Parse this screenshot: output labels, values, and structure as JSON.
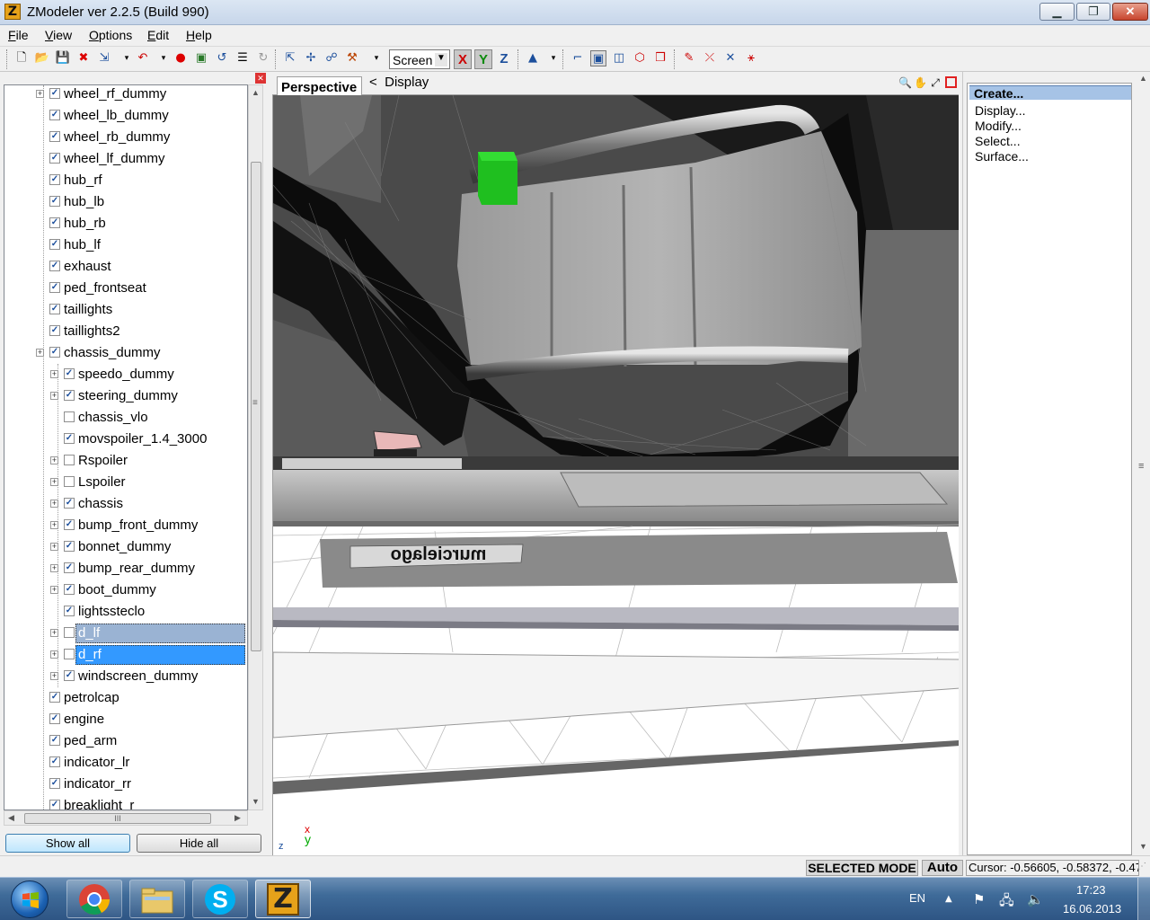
{
  "window": {
    "title": "ZModeler ver 2.2.5 (Build 990)",
    "app_icon_letter": "Z",
    "min_glyph": "▁",
    "max_glyph": "❐",
    "close_glyph": "✕"
  },
  "menu": [
    "File",
    "View",
    "Options",
    "Edit",
    "Help"
  ],
  "toolbar": {
    "view_select": "Screen",
    "axes": {
      "x": "X",
      "y": "Y",
      "z": "Z"
    }
  },
  "tree": {
    "items": [
      {
        "label": "wheel_rf_dummy",
        "checked": true,
        "expander": true,
        "level": 0
      },
      {
        "label": "wheel_lb_dummy",
        "checked": true,
        "expander": false,
        "level": 0
      },
      {
        "label": "wheel_rb_dummy",
        "checked": true,
        "expander": false,
        "level": 0
      },
      {
        "label": "wheel_lf_dummy",
        "checked": true,
        "expander": false,
        "level": 0
      },
      {
        "label": "hub_rf",
        "checked": true,
        "expander": false,
        "level": 0
      },
      {
        "label": "hub_lb",
        "checked": true,
        "expander": false,
        "level": 0
      },
      {
        "label": "hub_rb",
        "checked": true,
        "expander": false,
        "level": 0
      },
      {
        "label": "hub_lf",
        "checked": true,
        "expander": false,
        "level": 0
      },
      {
        "label": "exhaust",
        "checked": true,
        "expander": false,
        "level": 0
      },
      {
        "label": "ped_frontseat",
        "checked": true,
        "expander": false,
        "level": 0
      },
      {
        "label": "taillights",
        "checked": true,
        "expander": false,
        "level": 0
      },
      {
        "label": "taillights2",
        "checked": true,
        "expander": false,
        "level": 0
      },
      {
        "label": "chassis_dummy",
        "checked": true,
        "expander": true,
        "level": 0
      },
      {
        "label": "speedo_dummy",
        "checked": true,
        "expander": true,
        "level": 1
      },
      {
        "label": "steering_dummy",
        "checked": true,
        "expander": true,
        "level": 1
      },
      {
        "label": "chassis_vlo",
        "checked": false,
        "expander": false,
        "level": 1
      },
      {
        "label": "movspoiler_1.4_3000",
        "checked": true,
        "expander": false,
        "level": 1
      },
      {
        "label": "Rspoiler",
        "checked": false,
        "expander": true,
        "level": 1
      },
      {
        "label": "Lspoiler",
        "checked": false,
        "expander": true,
        "level": 1
      },
      {
        "label": "chassis",
        "checked": true,
        "expander": true,
        "level": 1
      },
      {
        "label": "bump_front_dummy",
        "checked": true,
        "expander": true,
        "level": 1
      },
      {
        "label": "bonnet_dummy",
        "checked": true,
        "expander": true,
        "level": 1
      },
      {
        "label": "bump_rear_dummy",
        "checked": true,
        "expander": true,
        "level": 1
      },
      {
        "label": "boot_dummy",
        "checked": true,
        "expander": true,
        "level": 1
      },
      {
        "label": "lightssteclo",
        "checked": true,
        "expander": false,
        "level": 1
      },
      {
        "label": "d_lf",
        "checked": false,
        "expander": true,
        "level": 1,
        "selected": "secondary"
      },
      {
        "label": "d_rf",
        "checked": false,
        "expander": true,
        "level": 1,
        "selected": "primary"
      },
      {
        "label": "windscreen_dummy",
        "checked": true,
        "expander": true,
        "level": 1
      },
      {
        "label": "petrolcap",
        "checked": true,
        "expander": false,
        "level": 0
      },
      {
        "label": "engine",
        "checked": true,
        "expander": false,
        "level": 0
      },
      {
        "label": "ped_arm",
        "checked": true,
        "expander": false,
        "level": 0
      },
      {
        "label": "indicator_lr",
        "checked": true,
        "expander": false,
        "level": 0
      },
      {
        "label": "indicator_rr",
        "checked": true,
        "expander": false,
        "level": 0
      },
      {
        "label": "breaklight_r",
        "checked": true,
        "expander": false,
        "level": 0
      }
    ],
    "hscroll_grip": "III",
    "vscroll_grip": "≡"
  },
  "buttons": {
    "show_all": "Show all",
    "hide_all": "Hide all"
  },
  "viewport": {
    "tab": "Perspective",
    "nav_glyph": "<",
    "display_label": "Display",
    "plate_text": "murcielago",
    "axis_x": "x",
    "axis_y": "y",
    "axis_z": "z"
  },
  "right_panel": {
    "items": [
      "Create...",
      "Display...",
      "Modify...",
      "Select...",
      "Surface..."
    ]
  },
  "status": {
    "mode": "SELECTED MODE",
    "auto": "Auto",
    "cursor": "Cursor: -0.56605, -0.58372, -0.47"
  },
  "taskbar": {
    "lang": "EN",
    "time": "17:23",
    "date": "16.06.2013",
    "zmodeler_letter": "Z"
  },
  "colors": {
    "selection_primary": "#3399ff",
    "selection_secondary": "#9ab3d3",
    "dummy_green": "#1fbf1f",
    "titlebar": "#c7d6ea",
    "close_red": "#c8452e"
  }
}
